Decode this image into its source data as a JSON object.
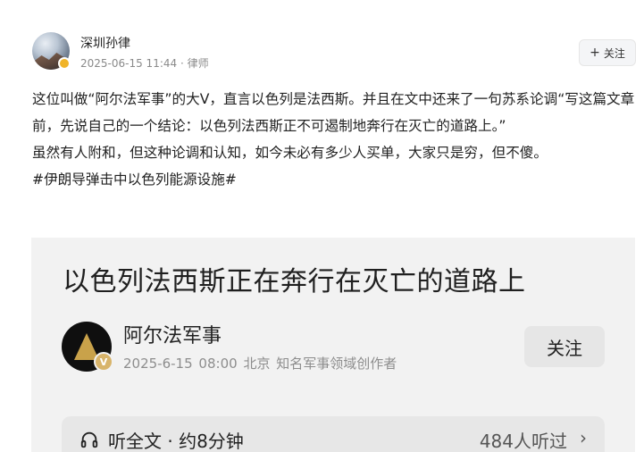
{
  "post": {
    "author": "深圳孙律",
    "date": "2025-06-15 11:44",
    "separator": " · ",
    "role": "律师",
    "follow_label": "关注",
    "follow_plus": "+",
    "paragraphs": [
      "这位叫做“阿尔法军事”的大V，直言以色列是法西斯。并且在文中还来了一句苏系论调“写这篇文章前，先说自己的一个结论：以色列法西斯正不可遏制地奔行在灭亡的道路上。”",
      "虽然有人附和，但这种论调和认知，如今未必有多少人买单，大家只是穷，但不傻。"
    ],
    "hashtag": "#伊朗导弹击中以色列能源设施#"
  },
  "embed": {
    "title": "以色列法西斯正在奔行在灭亡的道路上",
    "author": "阿尔法军事",
    "badge": "V",
    "date": "2025-6-15",
    "time": "08:00",
    "location": "北京",
    "tag": "知名军事领域创作者",
    "follow_label": "关注",
    "listen_label": "听全文 · 约8分钟",
    "listen_count": "484人听过",
    "listen_arrow": "›"
  },
  "colors": {
    "badge_gold": "#f0b429",
    "embed_bg": "#f2f2f2",
    "muted_text": "#8a8a8a"
  },
  "icons": [
    "avatar",
    "verified-badge-icon",
    "headphones-icon",
    "chevron-right-icon"
  ]
}
